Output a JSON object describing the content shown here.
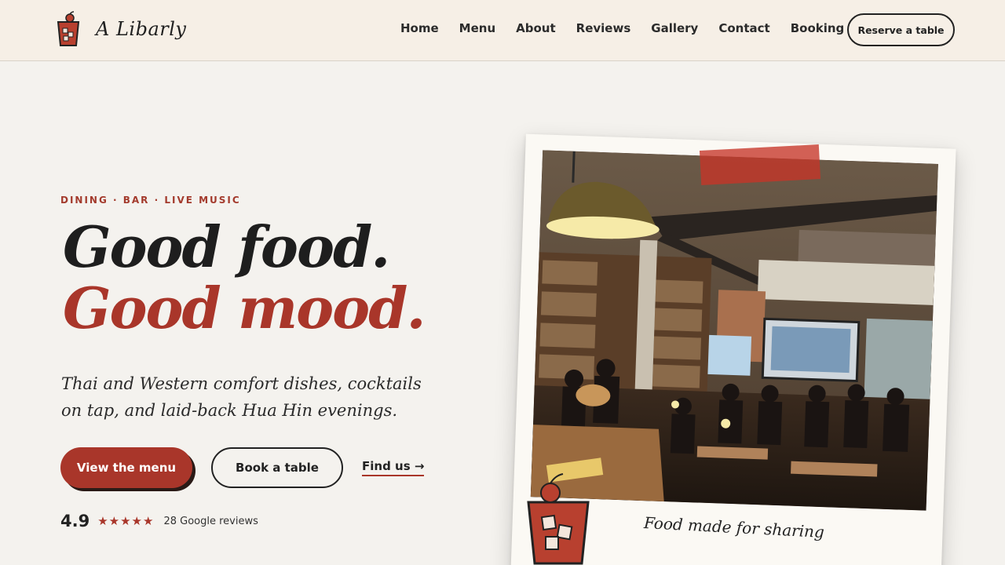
{
  "brand": {
    "name": "A Libarly",
    "logo_icon": "cocktail-glass-icon"
  },
  "nav": {
    "items": [
      "Home",
      "Menu",
      "About",
      "Reviews",
      "Gallery",
      "Contact",
      "Booking"
    ],
    "cta": "Reserve a table"
  },
  "hero": {
    "eyebrow": "DINING · BAR · LIVE MUSIC",
    "headline_line1": "Good food.",
    "headline_line2": "Good mood.",
    "subtitle": "Thai and Western comfort dishes, cocktails on tap, and laid-back Hua Hin evenings.",
    "primary_button": "View the menu",
    "secondary_button": "Book a table",
    "link": "Find us →",
    "rating": {
      "score": "4.9",
      "stars": "★★★★★",
      "text": "28 Google reviews"
    }
  },
  "photo": {
    "caption": "Food made for sharing",
    "description_icon": "restaurant-photo"
  },
  "colors": {
    "accent": "#a9362a",
    "background": "#f4f2ee",
    "header_bg": "#f6efe6",
    "text": "#222222"
  }
}
